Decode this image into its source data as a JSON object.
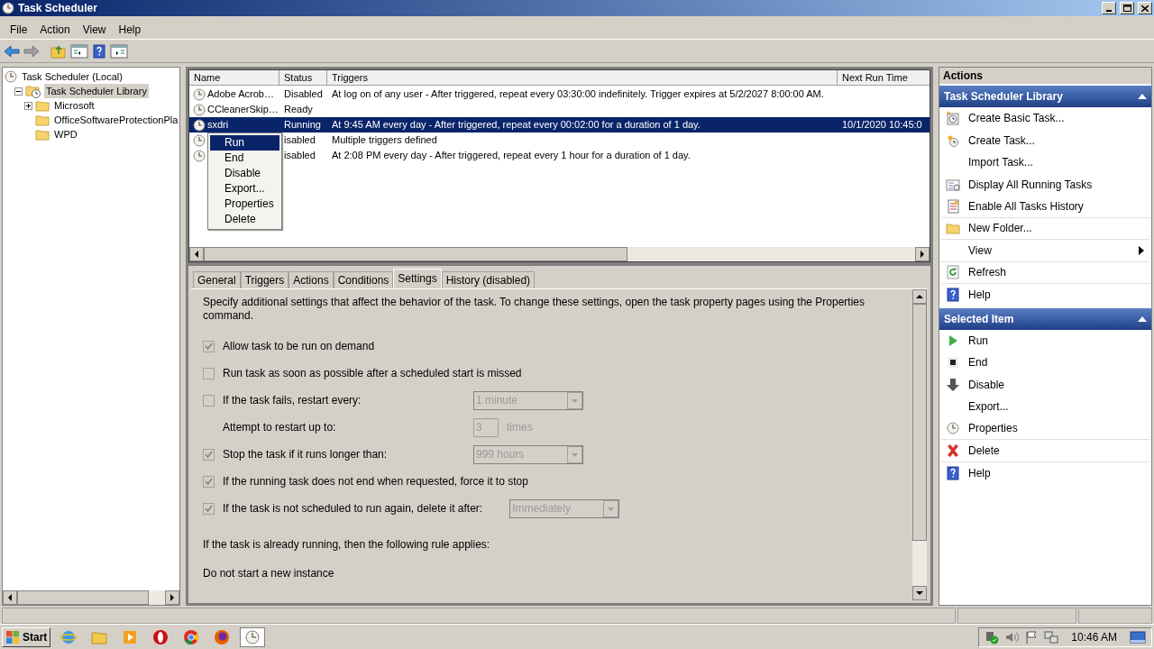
{
  "window": {
    "title": "Task Scheduler"
  },
  "menu": [
    "File",
    "Action",
    "View",
    "Help"
  ],
  "tree": [
    {
      "label": "Task Scheduler (Local)",
      "selected": false,
      "children": [
        {
          "label": "Task Scheduler Library",
          "expanded": true,
          "selected": true,
          "children": [
            {
              "label": "Microsoft",
              "expanded": false,
              "selected": false
            },
            {
              "label": "OfficeSoftwareProtectionPla",
              "selected": false
            },
            {
              "label": "WPD",
              "selected": false
            }
          ]
        }
      ]
    }
  ],
  "tasks": {
    "columns": [
      "Name",
      "Status",
      "Triggers",
      "Next Run Time"
    ],
    "rows": [
      {
        "name": "Adobe Acrob…",
        "status": "Disabled",
        "triggers": "At log on of any user - After triggered, repeat every 03:30:00 indefinitely. Trigger expires at 5/2/2027 8:00:00 AM.",
        "selected": false
      },
      {
        "name": "CCleanerSkip…",
        "status": "Ready",
        "selected": false
      },
      {
        "name": "sxdri",
        "status": "Running",
        "triggers": "At 9:45 AM every day - After triggered, repeat every 00:02:00 for a duration of 1 day.",
        "next_run": "10/1/2020 10:45:0",
        "selected": true
      },
      {
        "status": "isabled",
        "triggers": "Multiple triggers defined",
        "selected": false
      },
      {
        "status": "isabled",
        "triggers": "At 2:08 PM every day - After triggered, repeat every 1 hour for a duration of 1 day.",
        "selected": false
      }
    ]
  },
  "context_menu": [
    {
      "label": "Run",
      "selected": true
    },
    {
      "label": "End",
      "selected": false
    },
    {
      "label": "Disable",
      "selected": false
    },
    {
      "label": "Export...",
      "selected": false
    },
    {
      "label": "Properties",
      "selected": false
    },
    {
      "label": "Delete",
      "selected": false
    }
  ],
  "detail_tabs": [
    {
      "label": "General",
      "selected": false
    },
    {
      "label": "Triggers",
      "selected": false
    },
    {
      "label": "Actions",
      "selected": false
    },
    {
      "label": "Conditions",
      "selected": false
    },
    {
      "label": "Settings",
      "selected": true
    },
    {
      "label": "History (disabled)",
      "selected": false
    }
  ],
  "settings": {
    "intro": "Specify additional settings that affect the behavior of the task. To change these settings, open the task property pages using the Properties command.",
    "items": [
      {
        "kind": "check",
        "label": "Allow task to be run on demand",
        "checked": true
      },
      {
        "kind": "check",
        "label": "Run task as soon as possible after a scheduled start is missed",
        "checked": false
      },
      {
        "kind": "check",
        "label": "If the task fails, restart every:",
        "checked": false,
        "control": {
          "kind": "dropdown",
          "value": "1 minute"
        }
      },
      {
        "kind": "plain",
        "label": "Attempt to restart up to:",
        "control": {
          "kind": "spin",
          "value": "3",
          "unit": "times"
        }
      },
      {
        "kind": "check",
        "label": "Stop the task if it runs longer than:",
        "checked": true,
        "control": {
          "kind": "dropdown",
          "value": "999 hours"
        }
      },
      {
        "kind": "check",
        "label": "If the running task does not end when requested, force it to stop",
        "checked": true
      },
      {
        "kind": "check",
        "label": "If the task is not scheduled to run again, delete it after:",
        "checked": true,
        "control": {
          "kind": "dropdown",
          "value": "Immediately"
        }
      }
    ],
    "rule_label": "If the task is already running, then the following rule applies:",
    "rule_value": "Do not start a new instance"
  },
  "actions": {
    "title": "Actions",
    "sections": [
      {
        "title": "Task Scheduler Library",
        "items": [
          {
            "label": "Create Basic Task..."
          },
          {
            "label": "Create Task..."
          },
          {
            "label": "Import Task..."
          },
          {
            "label": "Display All Running Tasks"
          },
          {
            "label": "Enable All Tasks History"
          },
          {
            "label": "New Folder..."
          },
          {
            "label": "View",
            "submenu": true
          },
          {
            "label": "Refresh"
          },
          {
            "label": "Help"
          }
        ]
      },
      {
        "title": "Selected Item",
        "items": [
          {
            "label": "Run"
          },
          {
            "label": "End"
          },
          {
            "label": "Disable"
          },
          {
            "label": "Export..."
          },
          {
            "label": "Properties"
          },
          {
            "label": "Delete"
          },
          {
            "label": "Help"
          }
        ]
      }
    ]
  },
  "taskbar": {
    "start": "Start",
    "clock": "10:46 AM"
  }
}
